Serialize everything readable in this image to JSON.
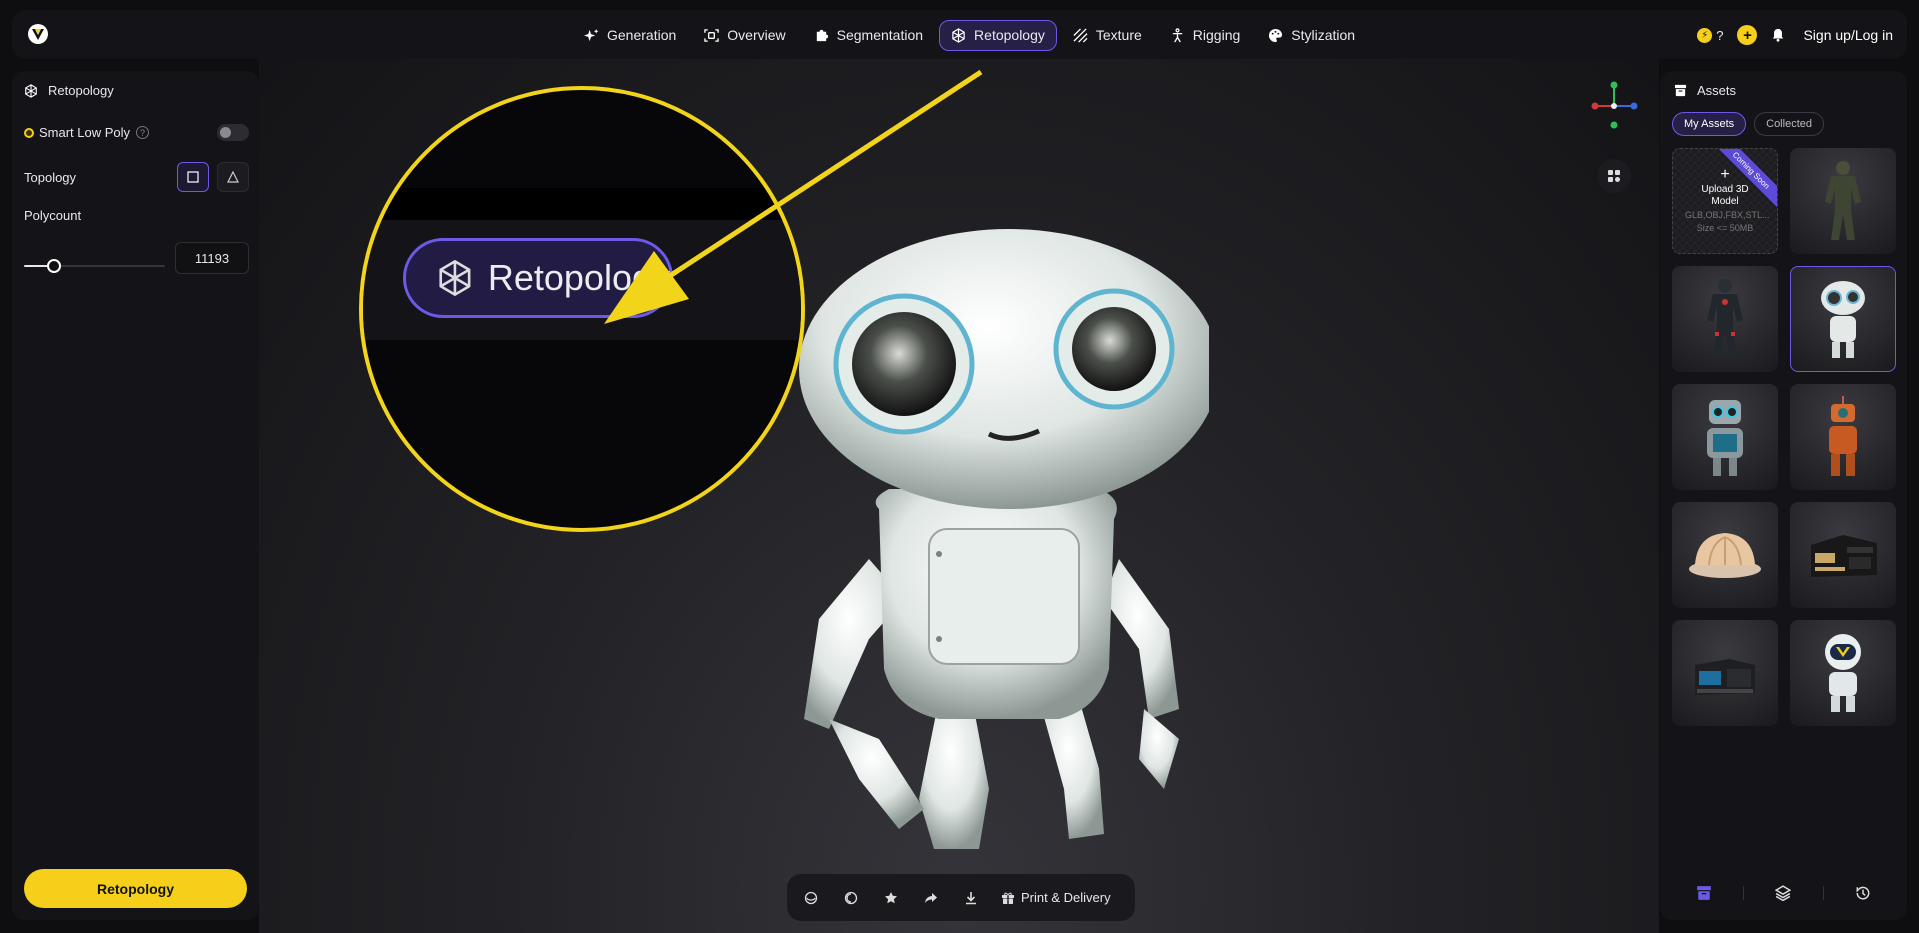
{
  "nav": {
    "items": [
      {
        "label": "Generation",
        "icon": "sparkle-icon"
      },
      {
        "label": "Overview",
        "icon": "scan-icon"
      },
      {
        "label": "Segmentation",
        "icon": "puzzle-icon"
      },
      {
        "label": "Retopology",
        "icon": "hexagon-mesh-icon",
        "active": true
      },
      {
        "label": "Texture",
        "icon": "hatch-icon"
      },
      {
        "label": "Rigging",
        "icon": "figure-icon"
      },
      {
        "label": "Stylization",
        "icon": "palette-icon"
      }
    ],
    "credits": "?",
    "signin": "Sign up/Log in"
  },
  "left_panel": {
    "title": "Retopology",
    "smart_low_poly": "Smart Low Poly",
    "help": "?",
    "topology_label": "Topology",
    "polycount_label": "Polycount",
    "polycount_value": "11193",
    "slider_fraction": 0.21,
    "action_button": "Retopology"
  },
  "viewport": {
    "zoom_label": "Retopology",
    "print_delivery": "Print & Delivery"
  },
  "right_panel": {
    "title": "Assets",
    "tabs": [
      "My Assets",
      "Collected"
    ],
    "upload": {
      "plus": "+",
      "label": "Upload 3D Model",
      "formats": "GLB,OBJ,FBX,STL...",
      "size": "Size <= 50MB",
      "ribbon": "Coming Soon"
    }
  },
  "colors": {
    "accent": "#6b5ae6",
    "yellow": "#f5cf19",
    "panel": "#141418"
  }
}
